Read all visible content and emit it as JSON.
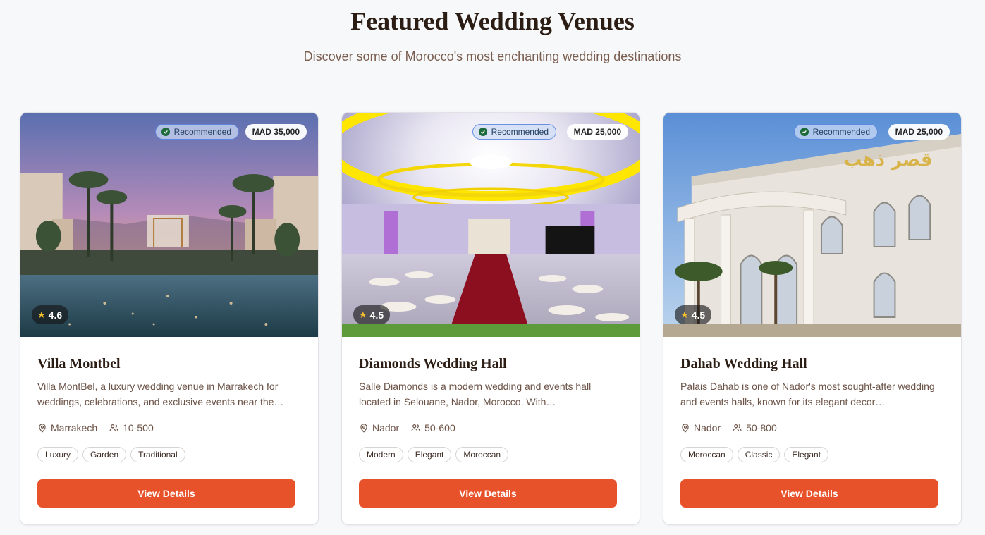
{
  "section": {
    "title": "Featured Wedding Venues",
    "subtitle": "Discover some of Morocco's most enchanting wedding destinations"
  },
  "venues": [
    {
      "name": "Villa Montbel",
      "recommended_label": "Recommended",
      "price": "MAD 35,000",
      "rating": "4.6",
      "description": "Villa MontBel, a luxury wedding venue in Marrakech for weddings, celebrations, and exclusive events near the…",
      "location": "Marrakech",
      "capacity": "10-500",
      "tags": [
        "Luxury",
        "Garden",
        "Traditional"
      ],
      "cta": "View Details"
    },
    {
      "name": "Diamonds Wedding Hall",
      "recommended_label": "Recommended",
      "price": "MAD 25,000",
      "rating": "4.5",
      "description": "Salle Diamonds is a modern wedding and events hall located in Selouane, Nador, Morocco. With…",
      "location": "Nador",
      "capacity": "50-600",
      "tags": [
        "Modern",
        "Elegant",
        "Moroccan"
      ],
      "cta": "View Details"
    },
    {
      "name": "Dahab Wedding Hall",
      "recommended_label": "Recommended",
      "price": "MAD 25,000",
      "rating": "4.5",
      "description": "Palais Dahab is one of Nador's most sought-after wedding and events halls, known for its elegant decor…",
      "location": "Nador",
      "capacity": "50-800",
      "tags": [
        "Moroccan",
        "Classic",
        "Elegant"
      ],
      "cta": "View Details",
      "sign_text": "قصر ذهب"
    }
  ],
  "colors": {
    "accent": "#e8522a",
    "heading": "#2b1d14",
    "body_text": "#6b5246",
    "recommended_check": "#1d6b3a",
    "rating_star": "#f6c02b"
  },
  "icons": {
    "recommended": "check-circle-icon",
    "rating": "star-icon",
    "location": "map-pin-icon",
    "capacity": "users-icon"
  }
}
